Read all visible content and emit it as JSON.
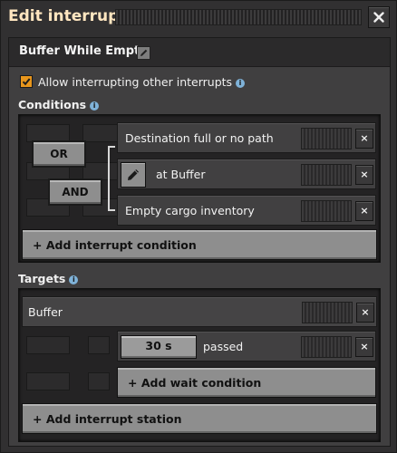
{
  "window": {
    "title": "Edit interrupt",
    "close_icon": "close-icon"
  },
  "schedule": {
    "name": "Buffer While Empty",
    "rename_icon": "pencil-icon"
  },
  "allow_interrupting": {
    "label": "Allow interrupting other interrupts",
    "checked": true,
    "info_icon": "info-icon"
  },
  "conditions": {
    "label": "Conditions",
    "or_label": "OR",
    "and_label": "AND",
    "rows": [
      {
        "text": "Destination full or no path",
        "close": "×"
      },
      {
        "text": "at Buffer",
        "close": "×"
      },
      {
        "text": "Empty cargo inventory",
        "close": "×"
      }
    ],
    "add_label": "+ Add interrupt condition"
  },
  "targets": {
    "label": "Targets",
    "station": {
      "text": "Buffer",
      "close": "×"
    },
    "wait": {
      "time": "30 s",
      "text": "passed",
      "close": "×"
    },
    "add_wait_label": "+ Add wait condition",
    "add_station_label": "+ Add interrupt station"
  },
  "colors": {
    "accent": "#e8961c",
    "title": "#ffe6c0",
    "info": "#7fb2d8"
  }
}
